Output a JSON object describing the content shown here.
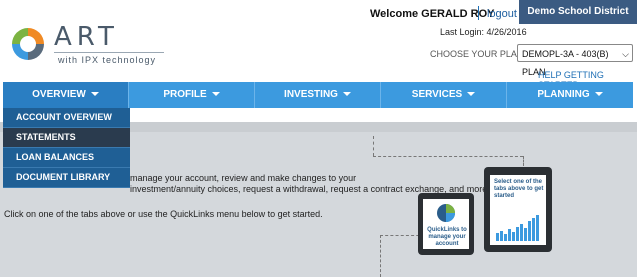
{
  "brand": {
    "name": "ART",
    "tagline": "with IPX technology"
  },
  "header": {
    "welcome": "Welcome GERALD ROY",
    "logout": "logout",
    "school_button": "Demo School District",
    "last_login": "Last Login: 4/26/2016",
    "choose_plan_label": "CHOOSE YOUR PLAN",
    "plan_value": "DEMOPL-3A - 403(B) PLAN",
    "help": "HELP GETTING STARTED"
  },
  "nav": {
    "items": [
      {
        "label": "OVERVIEW"
      },
      {
        "label": "PROFILE"
      },
      {
        "label": "INVESTING"
      },
      {
        "label": "SERVICES"
      },
      {
        "label": "PLANNING"
      }
    ]
  },
  "dropdown": {
    "items": [
      {
        "label": "ACCOUNT OVERVIEW"
      },
      {
        "label": "STATEMENTS"
      },
      {
        "label": "LOAN BALANCES"
      },
      {
        "label": "DOCUMENT LIBRARY"
      }
    ]
  },
  "main": {
    "line1": "manage your account, review and make changes to your",
    "line2": "investment/annuity choices, request a withdrawal, request a contract exchange, and more.",
    "line3": "Click on one of the tabs above or use the QuickLinks menu below to get started."
  },
  "tablets": {
    "small": "QuickLinks to manage your account",
    "large": "Select one of the tabs above to get started"
  },
  "colors": {
    "nav": "#3c9adf",
    "dropdown": "#1f5f95",
    "school_button": "#3b5b82"
  }
}
